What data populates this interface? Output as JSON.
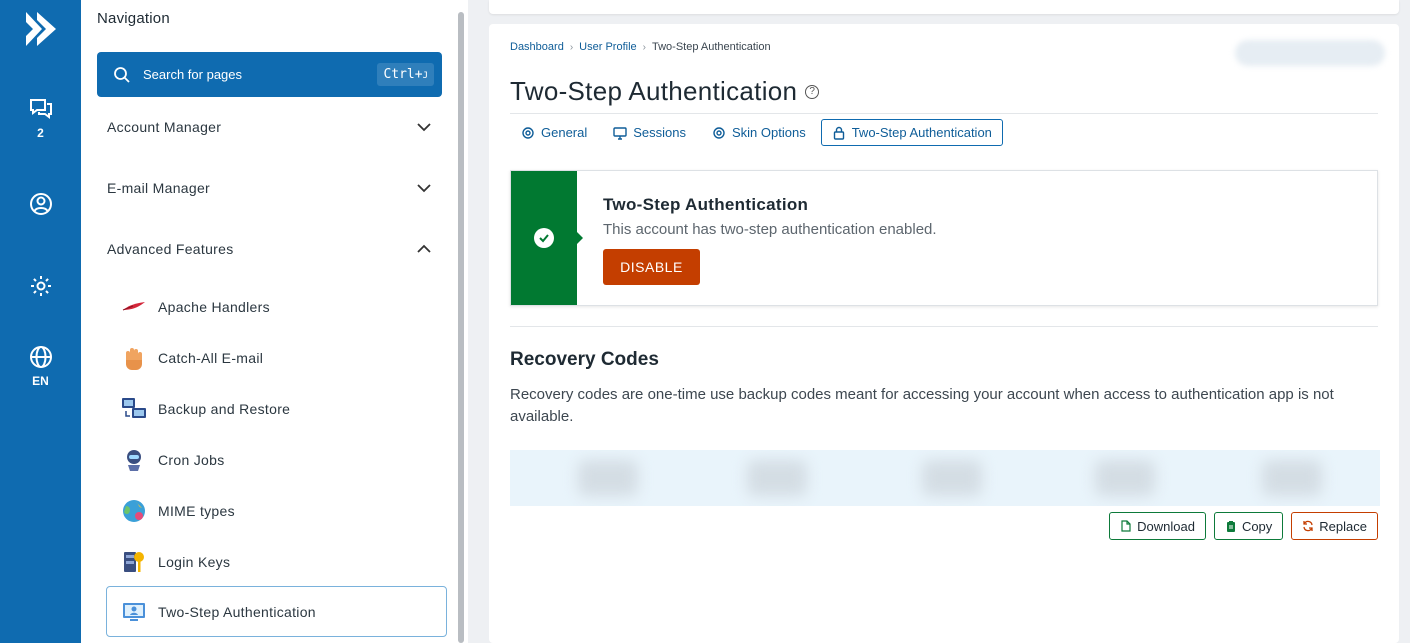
{
  "rail": {
    "feedback_count": "2",
    "language": "EN"
  },
  "nav": {
    "title": "Navigation",
    "search": {
      "placeholder": "Search for pages",
      "shortcut": "Ctrl+",
      "shortcut_key": "J"
    },
    "sections": [
      {
        "label": "Account Manager",
        "expanded": false
      },
      {
        "label": "E-mail Manager",
        "expanded": false
      },
      {
        "label": "Advanced Features",
        "expanded": true
      }
    ],
    "items": [
      {
        "label": "Apache Handlers",
        "icon": "feather-icon"
      },
      {
        "label": "Catch-All E-mail",
        "icon": "hand-icon"
      },
      {
        "label": "Backup and Restore",
        "icon": "computers-icon"
      },
      {
        "label": "Cron Jobs",
        "icon": "robot-icon"
      },
      {
        "label": "MIME types",
        "icon": "globe-icon"
      },
      {
        "label": "Login Keys",
        "icon": "key-icon"
      },
      {
        "label": "Two-Step Authentication",
        "icon": "auth-screen-icon",
        "active": true
      }
    ]
  },
  "breadcrumb": {
    "items": [
      "Dashboard",
      "User Profile",
      "Two-Step Authentication"
    ]
  },
  "page": {
    "title": "Two-Step Authentication",
    "help": "?",
    "tabs": [
      {
        "label": "General",
        "icon": "gear-icon"
      },
      {
        "label": "Sessions",
        "icon": "monitor-icon"
      },
      {
        "label": "Skin Options",
        "icon": "gear-icon"
      },
      {
        "label": "Two-Step Authentication",
        "icon": "lock-icon",
        "active": true
      }
    ]
  },
  "status": {
    "title": "Two-Step Authentication",
    "message": "This account has two-step authentication enabled.",
    "disable_label": "DISABLE"
  },
  "recovery": {
    "title": "Recovery Codes",
    "description": "Recovery codes are one-time use backup codes meant for accessing your account when access to authentication app is not available.",
    "actions": {
      "download": "Download",
      "copy": "Copy",
      "replace": "Replace"
    }
  },
  "colors": {
    "brand": "#0f6bb0",
    "success": "#017931",
    "danger": "#c43e00"
  }
}
